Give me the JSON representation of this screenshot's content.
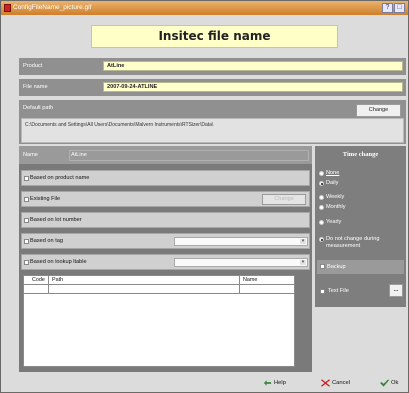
{
  "window": {
    "title": "ConfigFileName_picture.gif"
  },
  "titlebar_buttons": [
    "?",
    "□"
  ],
  "banner": {
    "title": "Insitec file name"
  },
  "product": {
    "label": "Product",
    "value": "AtLine"
  },
  "file_name": {
    "label": "File name",
    "value": "2007-09-24-ATLINE"
  },
  "default_path": {
    "label": "Default path",
    "change_label": "Change",
    "value": "C:\\Documents and Settings\\All Users\\Documents\\Malvern Instruments\\RTSizer\\Data\\"
  },
  "name_row": {
    "label": "Name",
    "value": "AtLine"
  },
  "options": {
    "based_on_product_name": "Based on product name",
    "existing_file": "Existing File",
    "existing_file_change": "Change",
    "based_on_lot_number": "Based on lot number",
    "based_on_tag": "Based on tag",
    "based_on_lookup_table": "Based on lookup ltable"
  },
  "lookup_table": {
    "columns": [
      "Code",
      "Path",
      "Name"
    ]
  },
  "time_change": {
    "title": "Time change",
    "options": [
      "None",
      "Daily",
      "Weekly",
      "Monthly",
      "Yearly",
      "Do not change during measurement"
    ],
    "selected": "Daily",
    "backup_label": "Backup",
    "text_file_label": "Text File",
    "text_file_button": "..."
  },
  "footer": {
    "help": "Help",
    "cancel": "Cancel",
    "ok": "Ok"
  },
  "colors": {
    "banner": "#ffffc8",
    "field": "#ffffcc",
    "title_bar": "#d88a3a"
  }
}
